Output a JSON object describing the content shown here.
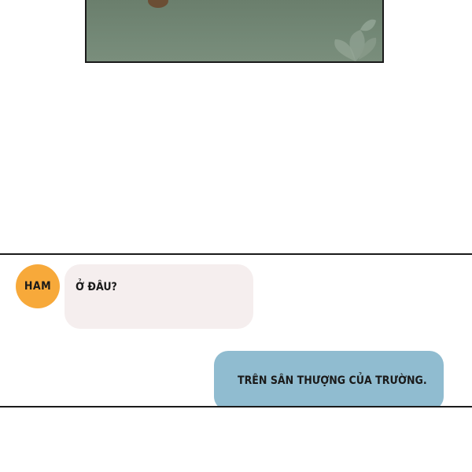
{
  "colors": {
    "page_background": "#ffffff",
    "panel_border": "#1a1a1a",
    "top_panel_fill": "#6f8472",
    "avatar_fill": "#f7a93a",
    "incoming_bubble": "#f5eeee",
    "outgoing_bubble": "#90bcd0"
  },
  "chat": {
    "avatar": {
      "label": "HAM"
    },
    "incoming": {
      "text": "Ở ĐÂU?"
    },
    "outgoing": {
      "text": "TRÊN SÂN THƯỢNG CỦA TRƯỜNG."
    }
  }
}
